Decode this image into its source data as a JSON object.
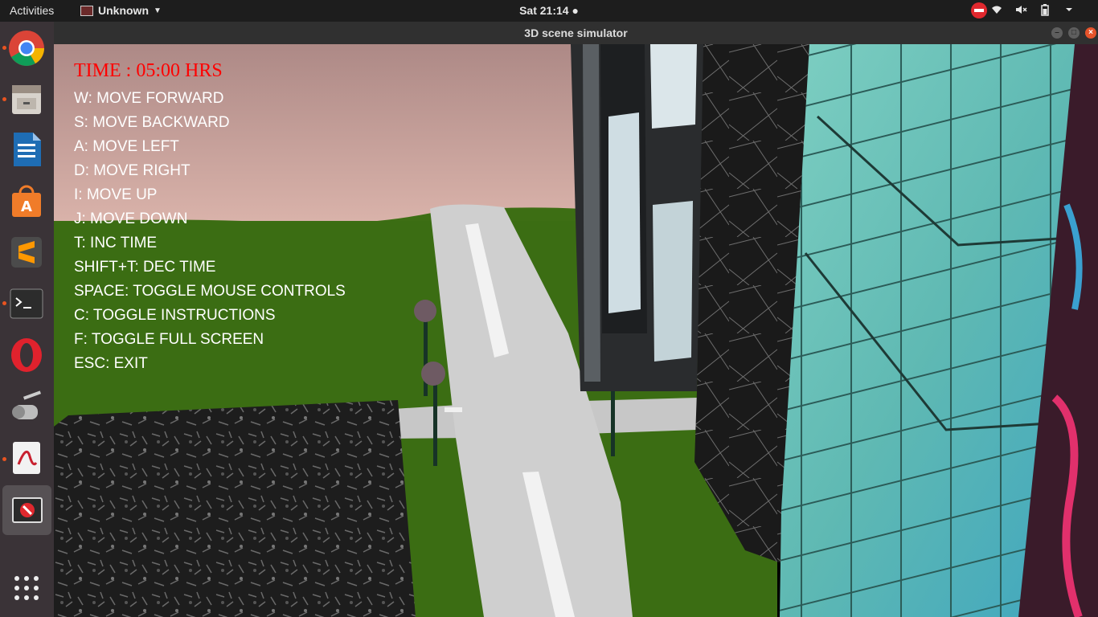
{
  "topbar": {
    "activities": "Activities",
    "app_menu": "Unknown",
    "clock": "Sat 21:14 ●"
  },
  "window": {
    "title": "3D scene simulator"
  },
  "hud": {
    "time": "TIME : 05:00 HRS",
    "instructions": [
      "W: MOVE FORWARD",
      "S: MOVE BACKWARD",
      "A: MOVE LEFT",
      "D: MOVE RIGHT",
      "I: MOVE UP",
      "J: MOVE DOWN",
      "T: INC TIME",
      "SHIFT+T: DEC TIME",
      "SPACE: TOGGLE MOUSE CONTROLS",
      "C: TOGGLE INSTRUCTIONS",
      "F: TOGGLE FULL SCREEN",
      "ESC: EXIT"
    ]
  },
  "dock": {
    "apps": [
      "chrome-icon",
      "files-icon",
      "writer-icon",
      "software-icon",
      "sublime-icon",
      "terminal-icon",
      "opera-icon",
      "scanner-icon",
      "pdf-icon",
      "blocked-app-icon",
      "show-apps-icon"
    ]
  },
  "colors": {
    "hud_time": "#ff0000",
    "hud_text": "#ffffff",
    "grass": "#3b6d13",
    "road": "#c9c9c9",
    "sky_top": "#b08a88",
    "accent": "#e95420"
  }
}
